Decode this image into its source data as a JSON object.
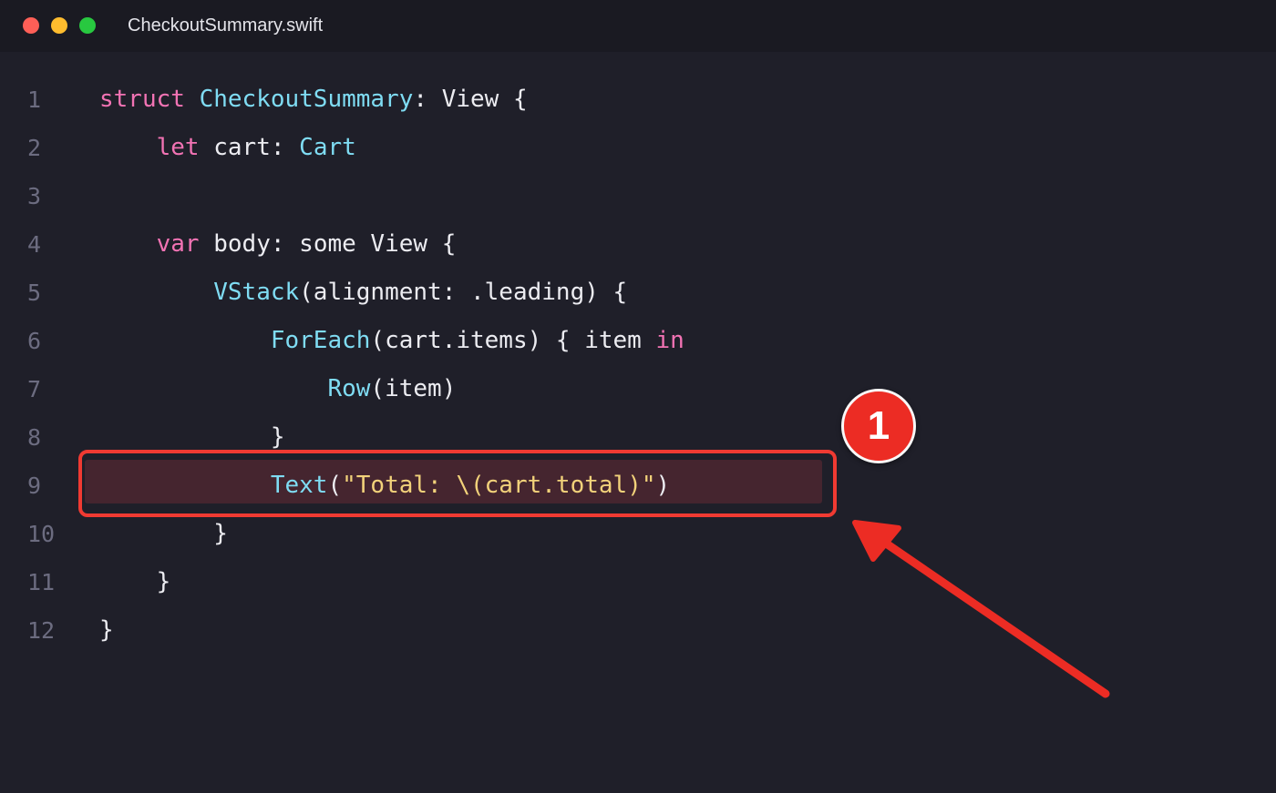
{
  "window": {
    "filename": "CheckoutSummary.swift",
    "highlight_color": "#45252f"
  },
  "editor": {
    "lines": [
      {
        "num": "1",
        "indent": "",
        "tokens": [
          {
            "t": "struct",
            "c": "kw"
          },
          {
            "t": " ",
            "c": ""
          },
          {
            "t": "CheckoutSummary",
            "c": "ty"
          },
          {
            "t": ": View {",
            "c": ""
          }
        ]
      },
      {
        "num": "2",
        "indent": "    ",
        "tokens": [
          {
            "t": "let",
            "c": "kw"
          },
          {
            "t": " cart: ",
            "c": ""
          },
          {
            "t": "Cart",
            "c": "ty"
          }
        ]
      },
      {
        "num": "3",
        "indent": "",
        "tokens": []
      },
      {
        "num": "4",
        "indent": "    ",
        "tokens": [
          {
            "t": "var",
            "c": "kw"
          },
          {
            "t": " body: some View {",
            "c": ""
          }
        ]
      },
      {
        "num": "5",
        "indent": "        ",
        "tokens": [
          {
            "t": "VStack",
            "c": "fn"
          },
          {
            "t": "(alignment: .leading) {",
            "c": ""
          }
        ]
      },
      {
        "num": "6",
        "indent": "            ",
        "tokens": [
          {
            "t": "ForEach",
            "c": "fn"
          },
          {
            "t": "(cart.items) { item ",
            "c": ""
          },
          {
            "t": "in",
            "c": "kw"
          }
        ]
      },
      {
        "num": "7",
        "indent": "                ",
        "tokens": [
          {
            "t": "Row",
            "c": "fn"
          },
          {
            "t": "(item)",
            "c": ""
          }
        ]
      },
      {
        "num": "8",
        "indent": "            ",
        "tokens": [
          {
            "t": "}",
            "c": ""
          }
        ]
      },
      {
        "num": "9",
        "indent": "            ",
        "tokens": [
          {
            "t": "Text",
            "c": "fn"
          },
          {
            "t": "(",
            "c": ""
          },
          {
            "t": "\"Total: \\(cart.total)\"",
            "c": "str"
          },
          {
            "t": ")",
            "c": ""
          }
        ],
        "highlighted": true
      },
      {
        "num": "10",
        "indent": "        ",
        "tokens": [
          {
            "t": "}",
            "c": ""
          }
        ]
      },
      {
        "num": "11",
        "indent": "    ",
        "tokens": [
          {
            "t": "}",
            "c": ""
          }
        ]
      },
      {
        "num": "12",
        "indent": "",
        "tokens": [
          {
            "t": "}",
            "c": ""
          }
        ]
      }
    ]
  },
  "annotation": {
    "badge_label": "1",
    "color": "#f03a32"
  }
}
